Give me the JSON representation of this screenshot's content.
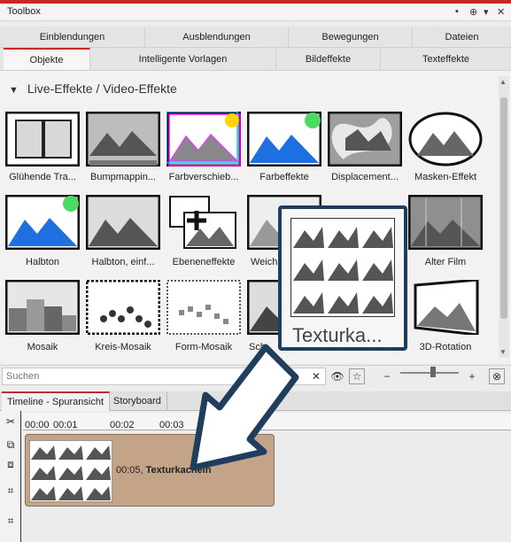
{
  "window": {
    "title": "Toolbox",
    "controls": [
      "▪",
      "⊕",
      "▾",
      "✕"
    ]
  },
  "tabs_row1": [
    "Einblendungen",
    "Ausblendungen",
    "Bewegungen",
    "Dateien"
  ],
  "tabs_row2": [
    "Objekte",
    "Intelligente Vorlagen",
    "Bildeffekte",
    "Texteffekte"
  ],
  "group": {
    "title": "Live-Effekte / Video-Effekte"
  },
  "effects": [
    "Glühende Tra...",
    "Bumpmappin...",
    "Farbverschieb...",
    "Farbeffekte",
    "Displacement...",
    "Masken-Effekt",
    "Halbton",
    "Halbton, einf...",
    "Ebeneneffekte",
    "Weich",
    "",
    "Alter Film",
    "Mosaik",
    "Kreis-Mosaik",
    "Form-Mosaik",
    "Sch",
    "",
    "3D-Rotation"
  ],
  "search": {
    "placeholder": "Suchen",
    "clear": "✕"
  },
  "popup": {
    "label": "Texturka..."
  },
  "timeline": {
    "tabs": [
      "Timeline - Spuransicht",
      "Storyboard"
    ],
    "ruler": [
      "00:00",
      "00:01",
      "00:02",
      "00:03"
    ],
    "clip": {
      "time": "00:05,",
      "name": "Texturkacheln"
    }
  },
  "colors": {
    "accent": "#c62828",
    "popup_border": "#1f3e5e",
    "clip": "#c4a488"
  }
}
